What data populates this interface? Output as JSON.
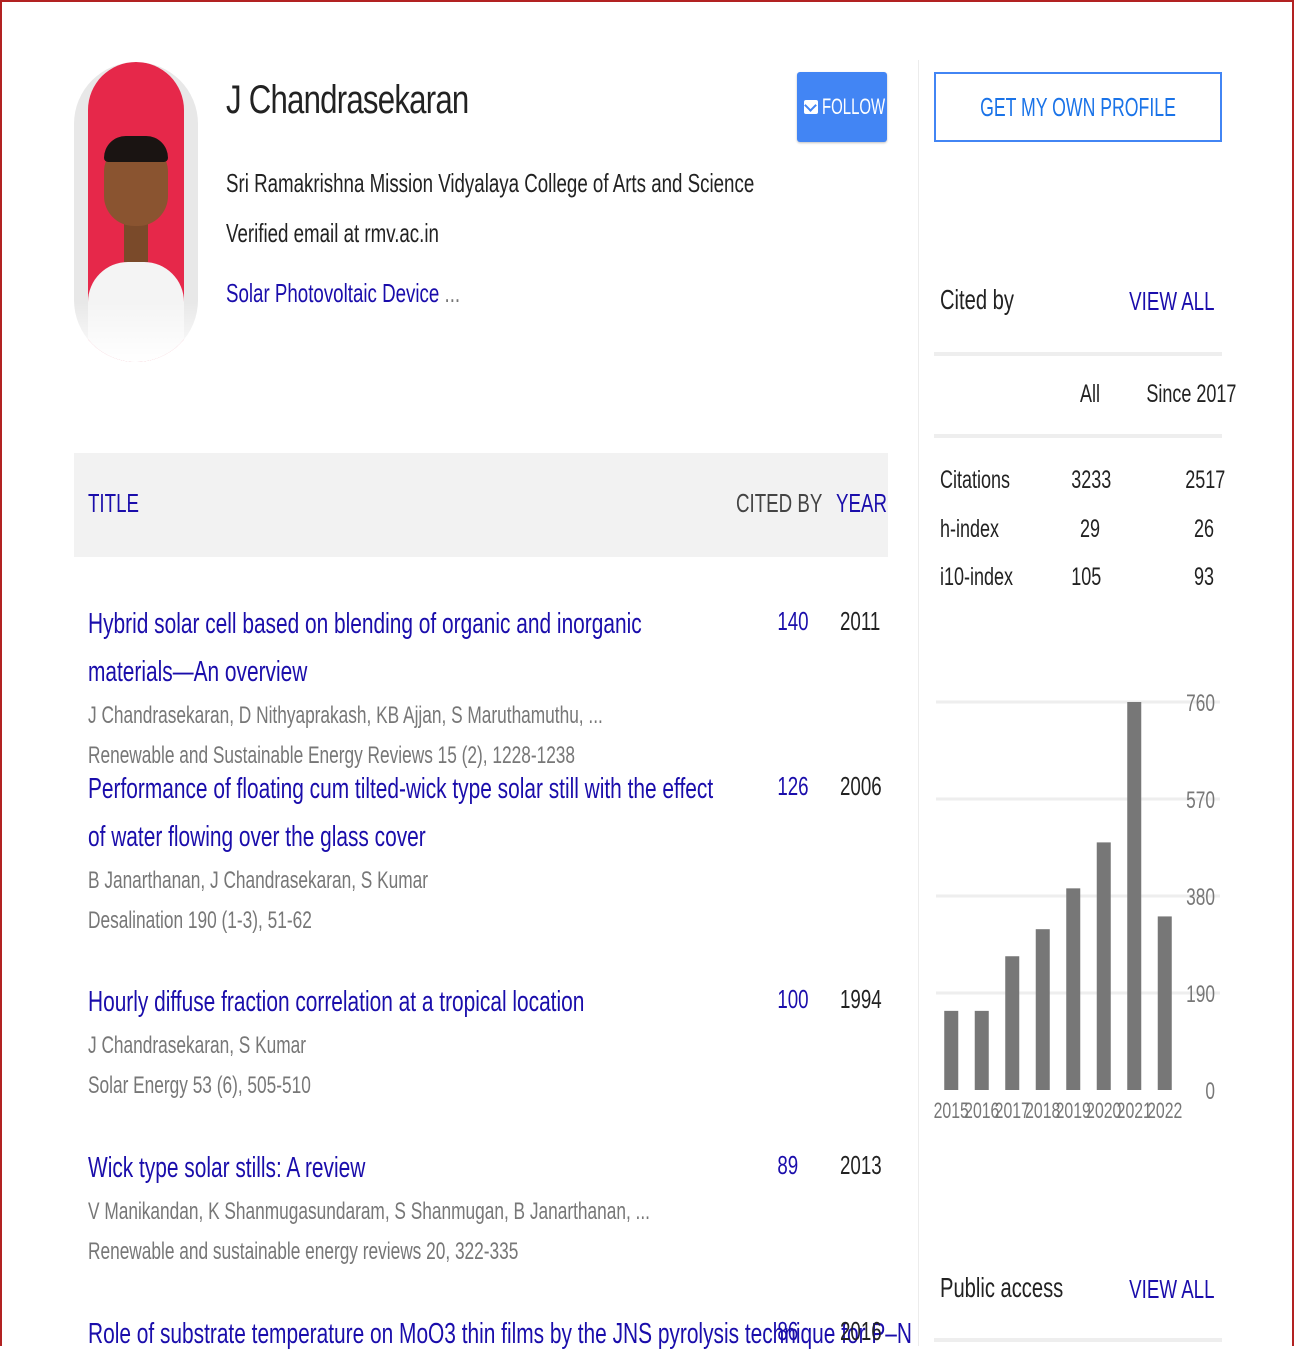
{
  "profile": {
    "name": "J Chandrasekaran",
    "affiliation": "Sri Ramakrishna Mission Vidyalaya College of Arts and Science",
    "email": "Verified email at rmv.ac.in",
    "interest": "Solar Photovoltaic Device",
    "interest_more": " ...",
    "follow_label": "FOLLOW",
    "get_profile_label": "GET MY OWN PROFILE"
  },
  "table": {
    "headers": {
      "title": "TITLE",
      "cited_by": "CITED BY",
      "year": "YEAR"
    },
    "rows": [
      {
        "title": "Hybrid solar cell based on blending of organic and inorganic materials—An overview",
        "authors": "J Chandrasekaran, D Nithyaprakash, KB Ajjan, S Maruthamuthu, ...",
        "venue": "Renewable and Sustainable Energy Reviews 15 (2), 1228-1238",
        "cited": "140",
        "year": "2011"
      },
      {
        "title": "Performance of floating cum tilted-wick type solar still with the effect of water flowing over the glass cover",
        "authors": "B Janarthanan, J Chandrasekaran, S Kumar",
        "venue": "Desalination 190 (1-3), 51-62",
        "cited": "126",
        "year": "2006"
      },
      {
        "title": "Hourly diffuse fraction correlation at a tropical location",
        "authors": "J Chandrasekaran, S Kumar",
        "venue": "Solar Energy 53 (6), 505-510",
        "cited": "100",
        "year": "1994"
      },
      {
        "title": "Wick type solar stills: A review",
        "authors": "V Manikandan, K Shanmugasundaram, S Shanmugan, B Janarthanan, ...",
        "venue": "Renewable and sustainable energy reviews 20, 322-335",
        "cited": "89",
        "year": "2013"
      },
      {
        "title": "Role of substrate temperature on MoO3 thin films by the JNS pyrolysis technique for P–N",
        "authors": "",
        "venue": "",
        "cited": "86",
        "year": "2016"
      }
    ]
  },
  "cited_by": {
    "label": "Cited by",
    "view_all": "VIEW ALL",
    "col_all": "All",
    "col_since": "Since 2017",
    "stats": [
      {
        "label": "Citations",
        "all": "3233",
        "since": "2517"
      },
      {
        "label": "h-index",
        "all": "29",
        "since": "26"
      },
      {
        "label": "i10-index",
        "all": "105",
        "since": "93"
      }
    ]
  },
  "public_access": {
    "label": "Public access",
    "view_all": "VIEW ALL"
  },
  "colors": {
    "link": "#1a0dab",
    "accent": "#4285f4",
    "bar": "#777777",
    "frame": "#b22222"
  },
  "chart_data": {
    "type": "bar",
    "categories": [
      "2015",
      "2016",
      "2017",
      "2018",
      "2019",
      "2020",
      "2021",
      "2022"
    ],
    "values": [
      155,
      155,
      262,
      315,
      395,
      485,
      760,
      340
    ],
    "yticks": [
      0,
      190,
      380,
      570,
      760
    ],
    "ylim": [
      0,
      800
    ],
    "grid": true,
    "y_axis_side": "right"
  }
}
